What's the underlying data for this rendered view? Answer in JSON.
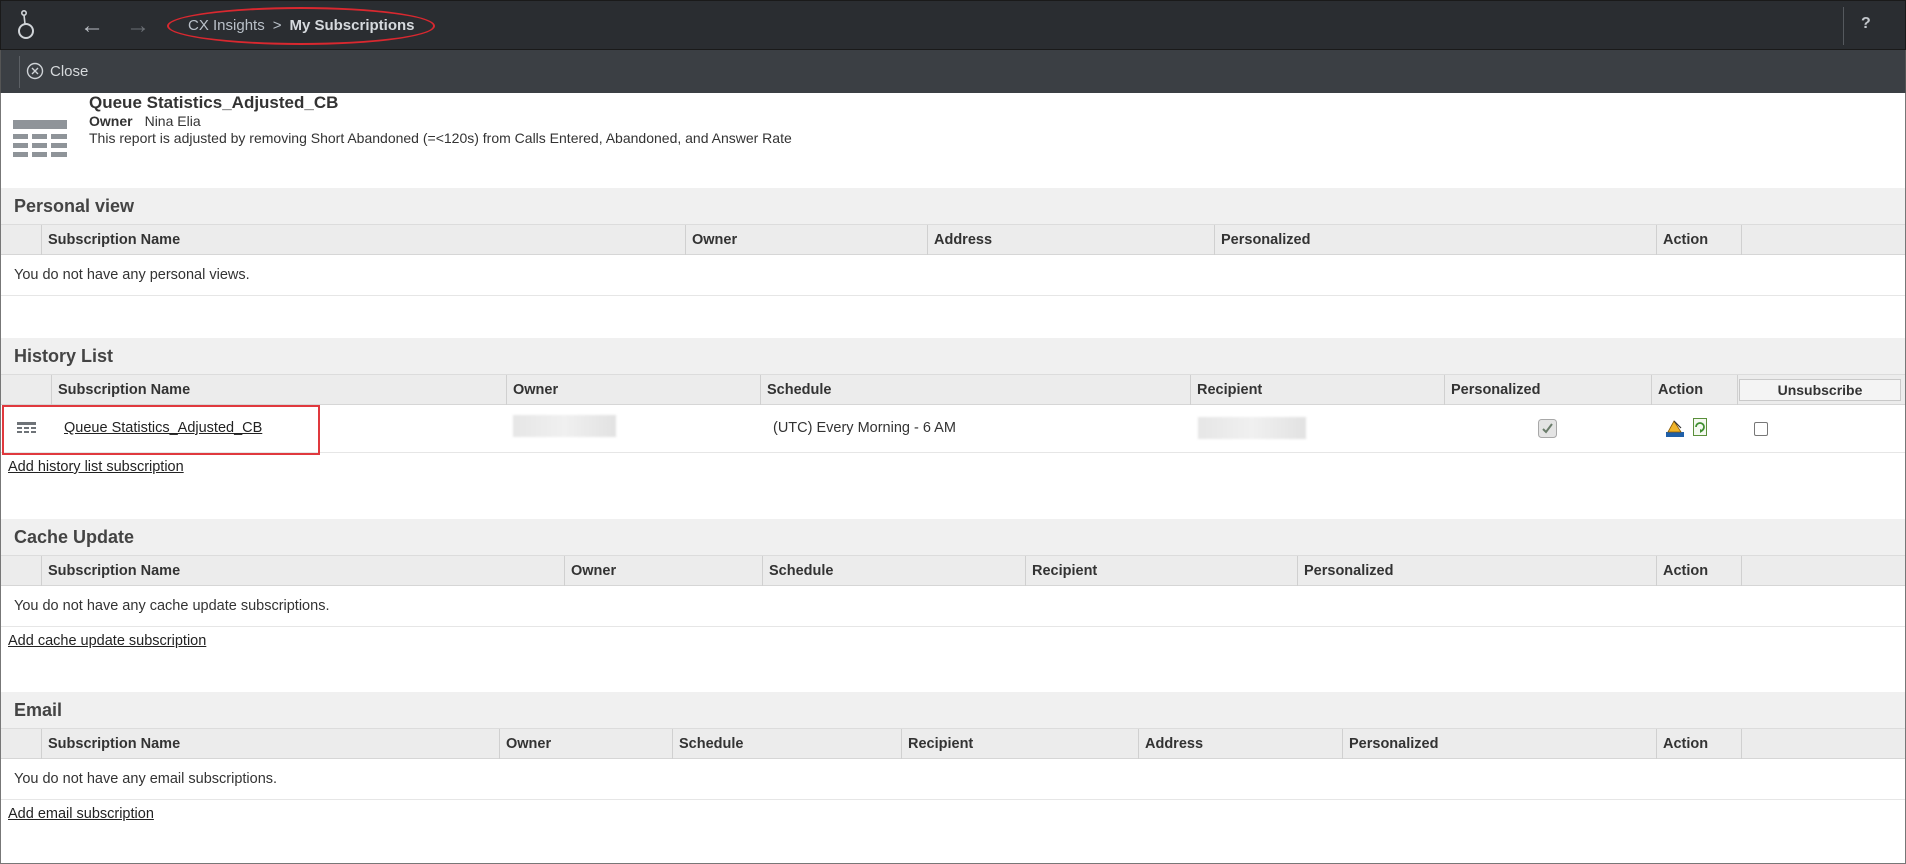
{
  "header": {
    "breadcrumb_root": "CX Insights",
    "breadcrumb_separator": ">",
    "breadcrumb_current": "My Subscriptions",
    "help_label": "?"
  },
  "toolbar": {
    "close_label": "Close"
  },
  "report": {
    "title": "Queue Statistics_Adjusted_CB",
    "owner_label": "Owner",
    "owner_name": "Nina Elia",
    "description": "This report is adjusted by removing Short Abandoned (=<120s) from Calls Entered, Abandoned, and Answer Rate"
  },
  "personal_view": {
    "title": "Personal view",
    "columns": [
      "Subscription Name",
      "Owner",
      "Address",
      "Personalized",
      "Action"
    ],
    "empty_message": "You do not have any personal views."
  },
  "history_list": {
    "title": "History List",
    "columns": [
      "Subscription Name",
      "Owner",
      "Schedule",
      "Recipient",
      "Personalized",
      "Action"
    ],
    "unsubscribe_label": "Unsubscribe",
    "rows": [
      {
        "name": "Queue Statistics_Adjusted_CB",
        "schedule": "(UTC) Every Morning - 6 AM",
        "personalized": true
      }
    ],
    "add_link": "Add history list subscription"
  },
  "cache_update": {
    "title": "Cache Update",
    "columns": [
      "Subscription Name",
      "Owner",
      "Schedule",
      "Recipient",
      "Personalized",
      "Action"
    ],
    "empty_message": "You do not have any cache update subscriptions.",
    "add_link": "Add cache update subscription"
  },
  "email": {
    "title": "Email",
    "columns": [
      "Subscription Name",
      "Owner",
      "Schedule",
      "Recipient",
      "Address",
      "Personalized",
      "Action"
    ],
    "empty_message": "You do not have any email subscriptions.",
    "add_link": "Add email subscription"
  },
  "colors": {
    "topbar": "#2a2d31",
    "toolbar": "#3b3f44",
    "highlight": "#e0393e"
  }
}
